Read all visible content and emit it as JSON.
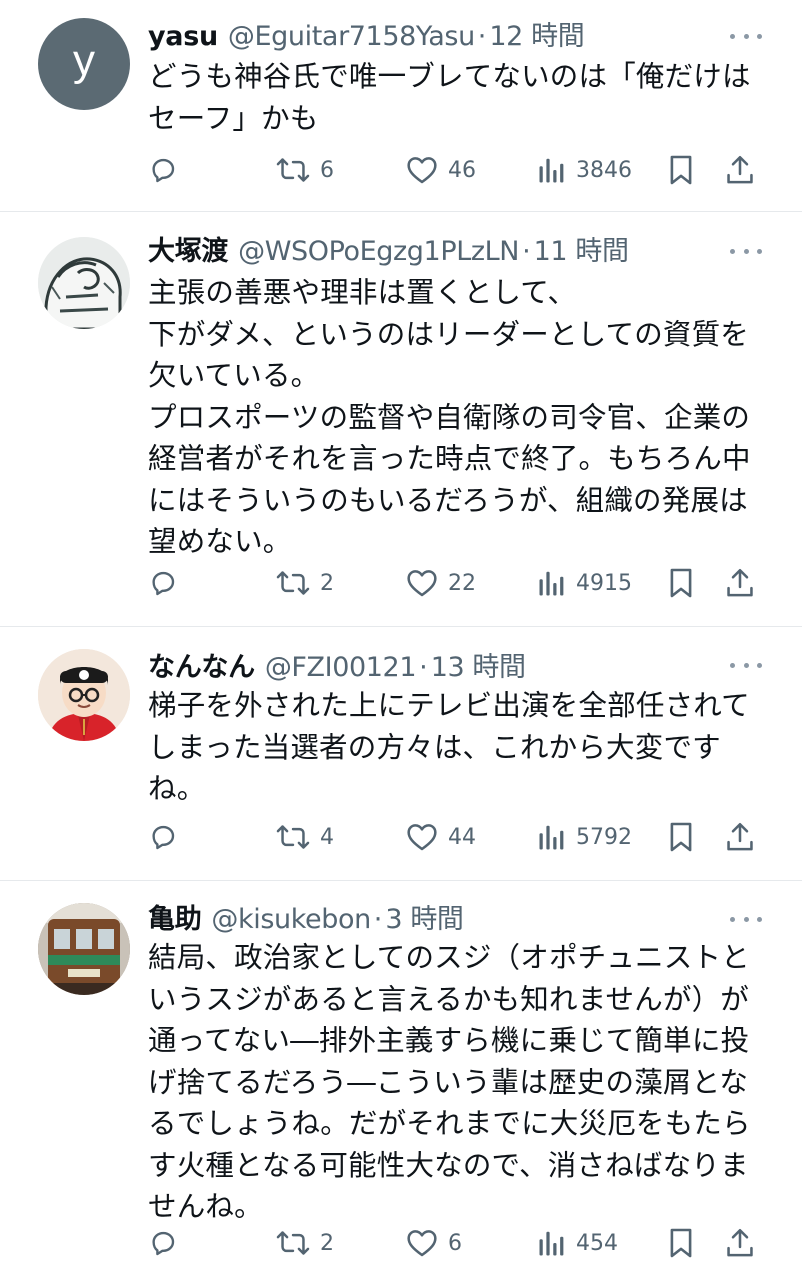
{
  "posts": [
    {
      "name": "yasu",
      "handle": "@Eguitar7158Yasu",
      "separator": "·",
      "time": "12 時間",
      "avatar_letter": "y",
      "lines": [
        "どうも神谷氏で唯一ブレてないのは「俺だけは",
        "セーフ」かも"
      ],
      "replies": "",
      "reposts": "6",
      "likes": "46",
      "views": "3846"
    },
    {
      "name": "大塚渡",
      "handle": "@WSOPoEgzg1PLzLN",
      "separator": "·",
      "time": "11 時間",
      "avatar_letter": "",
      "lines": [
        "主張の善悪や理非は置くとして、",
        "下がダメ、というのはリーダーとしての資質を",
        "欠いている。",
        "プロスポーツの監督や自衛隊の司令官、企業の",
        "経営者がそれを言った時点で終了。もちろん中",
        "にはそういうのもいるだろうが、組織の発展は",
        "望めない。"
      ],
      "replies": "",
      "reposts": "2",
      "likes": "22",
      "views": "4915"
    },
    {
      "name": "なんなん",
      "handle": "@FZI00121",
      "separator": "·",
      "time": "13 時間",
      "avatar_letter": "",
      "lines": [
        "梯子を外された上にテレビ出演を全部任されて",
        "しまった当選者の方々は、これから大変です",
        "ね。"
      ],
      "replies": "",
      "reposts": "4",
      "likes": "44",
      "views": "5792"
    },
    {
      "name": "亀助",
      "handle": "@kisukebon",
      "separator": "·",
      "time": "3 時間",
      "avatar_letter": "",
      "lines": [
        "結局、政治家としてのスジ（オポチュニストと",
        "いうスジがあると言えるかも知れませんが）が",
        "通ってない―排外主義すら機に乗じて簡単に投",
        "げ捨てるだろう―こういう輩は歴史の藻屑とな",
        "るでしょうね。だがそれまでに大災厄をもたら",
        "す火種となる可能性大なので、消さねばなりま",
        "せんね。"
      ],
      "replies": "",
      "reposts": "2",
      "likes": "6",
      "views": "454"
    }
  ],
  "colors": {
    "text": "#0f1419",
    "secondary": "#536471",
    "divider": "#e6e9ec",
    "avatar_gray": "#5b6a73"
  },
  "icons": [
    "reply-icon",
    "repost-icon",
    "like-icon",
    "views-icon",
    "bookmark-icon",
    "share-icon",
    "more-icon"
  ]
}
